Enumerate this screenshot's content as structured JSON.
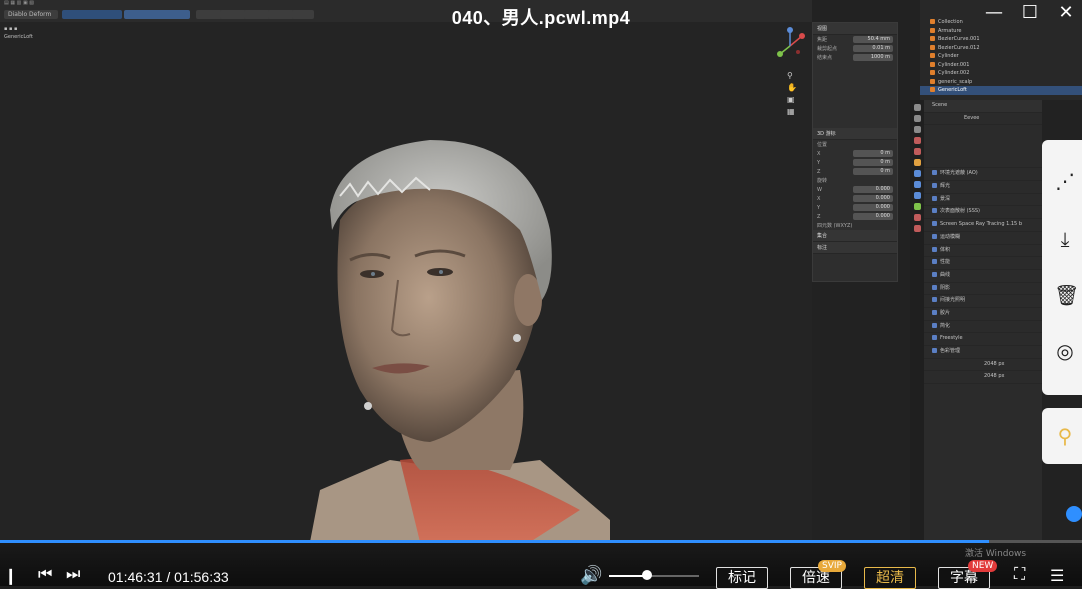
{
  "video": {
    "title": "040、男人.pcwl.mp4",
    "current_time": "01:46:31",
    "separator": "/",
    "total_time": "01:56:33",
    "progress_fraction": 0.914,
    "volume_fraction": 0.42,
    "buttons": {
      "bookmark": "标记",
      "speed": "倍速",
      "speed_badge": "SVIP",
      "quality": "超清",
      "subtitle": "字幕",
      "subtitle_badge": "NEW"
    },
    "watermark": "激活 Windows"
  },
  "blender": {
    "header": {
      "mode": "Diablo Deform"
    },
    "viewport": {
      "object_label": "GenericLoft"
    },
    "outliner": {
      "items": [
        {
          "label": "Collection",
          "selected": false
        },
        {
          "label": "Armature",
          "selected": false
        },
        {
          "label": "BezierCurve.001",
          "selected": false
        },
        {
          "label": "BezierCurve.012",
          "selected": false
        },
        {
          "label": "Cylinder",
          "selected": false
        },
        {
          "label": "Cylinder.001",
          "selected": false
        },
        {
          "label": "Cylinder.002",
          "selected": false
        },
        {
          "label": "generic_scalp",
          "selected": false
        },
        {
          "label": "GenericLoft",
          "selected": true
        }
      ]
    },
    "properties": {
      "scene": "Scene",
      "engine_value": "Eevee",
      "rows": [
        "环境光遮蔽 (AO)",
        "辉光",
        "景深",
        "次表面散射 (SSS)",
        "Screen Space Ray Tracing 1.15 b",
        "运动模糊",
        "体积",
        "性能",
        "曲线",
        "阴影",
        "间接光照明",
        "胶片",
        "简化",
        "Freestyle",
        "色彩管理"
      ],
      "shadow_size_1": "2048 px",
      "shadow_size_2": "2048 px"
    },
    "npanel": {
      "section_view": "视图",
      "focal_label": "焦距",
      "focal_value": "50.4 mm",
      "clip_start_label": "裁剪起点",
      "clip_start_value": "0.01 m",
      "clip_end_label": "结束点",
      "clip_end_value": "1000 m",
      "section_cursor": "3D 游标",
      "location_label": "位置",
      "loc": [
        "0 m",
        "0 m",
        "0 m"
      ],
      "rotation_label": "旋转",
      "rot": [
        "0.000",
        "0.000",
        "0.000",
        "0.000"
      ],
      "rot_mode": "四元数 (WXYZ)",
      "section_collections": "集合",
      "section_annotations": "标注"
    }
  },
  "sidebar": {
    "icons": [
      "share-icon",
      "download-icon",
      "trash-icon",
      "settings-icon",
      "pin-icon"
    ]
  }
}
